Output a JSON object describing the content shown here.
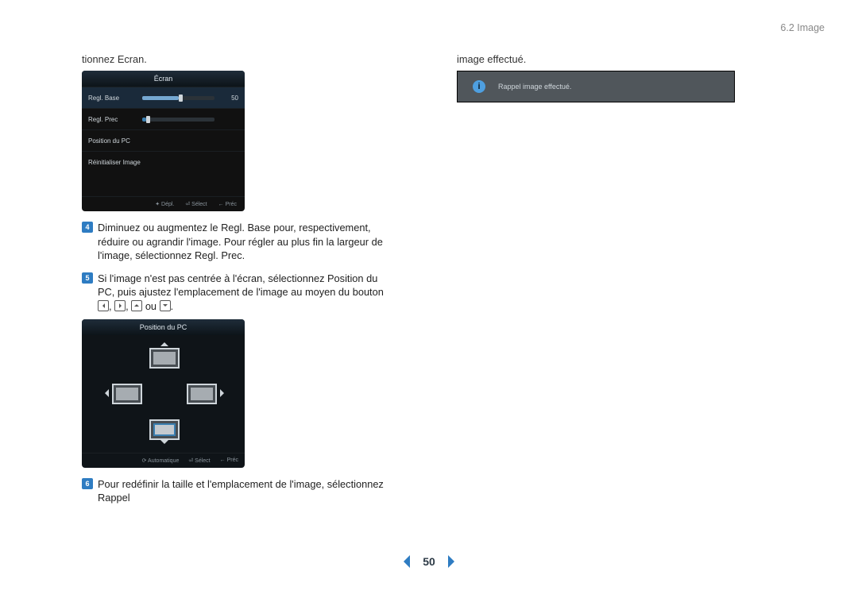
{
  "header": {
    "section": "6.2 Image"
  },
  "left": {
    "intro_tail": "tionnez Ecran.",
    "step4_num": "4",
    "step4_text": "Diminuez ou augmentez le Regl. Base pour, respectivement, réduire ou agrandir l'image. Pour régler au plus fin la largeur de l'image, sélectionnez Regl. Prec.",
    "step5_num": "5",
    "step5_text_a": "Si l'image n'est pas centrée à l'écran, sélectionnez Position du PC, puis ajustez l'emplacement de l'image au moyen du bouton ",
    "step5_text_b": " ou ",
    "step5_text_c": ".",
    "step6_num": "6",
    "step6_text": "Pour redéfinir la taille et l'emplacement de l'image, sélectionnez Rappel"
  },
  "osd1": {
    "title": "Écran",
    "row1_label": "Regl. Base",
    "row1_value": "50",
    "row1_fill_pct": 50,
    "row2_label": "Regl. Prec",
    "row2_fill_pct": 5,
    "row3_label": "Position du PC",
    "row4_label": "Réinitialiser Image",
    "footer_move": "Dépl.",
    "footer_select": "Sélect",
    "footer_back": "Préc"
  },
  "osd2": {
    "title": "Position du PC",
    "footer_auto": "Automatique",
    "footer_select": "Sélect",
    "footer_back": "Préc"
  },
  "right": {
    "intro_tail": "image effectué.",
    "popup_msg": "Rappel image effectué."
  },
  "pager": {
    "page": "50"
  }
}
